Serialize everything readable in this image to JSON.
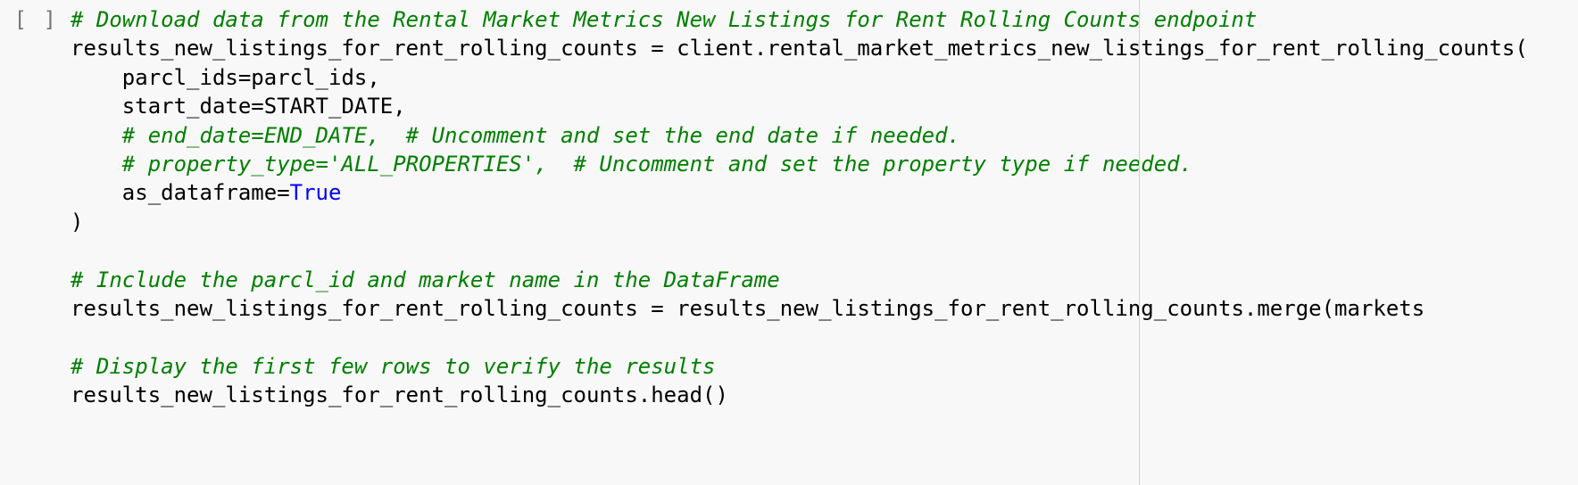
{
  "cell": {
    "execution_indicator": "[ ]",
    "lines": [
      [
        {
          "cls": "tok-comment",
          "text": "# Download data from the Rental Market Metrics New Listings for Rent Rolling Counts endpoint"
        }
      ],
      [
        {
          "cls": "tok-ident",
          "text": "results_new_listings_for_rent_rolling_counts "
        },
        {
          "cls": "tok-op",
          "text": "="
        },
        {
          "cls": "tok-ident",
          "text": " client"
        },
        {
          "cls": "tok-punct",
          "text": "."
        },
        {
          "cls": "tok-ident",
          "text": "rental_market_metrics_new_listings_for_rent_rolling_counts("
        }
      ],
      [
        {
          "cls": "tok-ident",
          "text": "    parcl_ids"
        },
        {
          "cls": "tok-op",
          "text": "="
        },
        {
          "cls": "tok-ident",
          "text": "parcl_ids"
        },
        {
          "cls": "tok-punct",
          "text": ","
        }
      ],
      [
        {
          "cls": "tok-ident",
          "text": "    start_date"
        },
        {
          "cls": "tok-op",
          "text": "="
        },
        {
          "cls": "tok-ident",
          "text": "START_DATE"
        },
        {
          "cls": "tok-punct",
          "text": ","
        }
      ],
      [
        {
          "cls": "tok-ident",
          "text": "    "
        },
        {
          "cls": "tok-comment",
          "text": "# end_date=END_DATE,  # Uncomment and set the end date if needed."
        }
      ],
      [
        {
          "cls": "tok-ident",
          "text": "    "
        },
        {
          "cls": "tok-comment",
          "text": "# property_type='ALL_PROPERTIES',  # Uncomment and set the property type if needed."
        }
      ],
      [
        {
          "cls": "tok-ident",
          "text": "    as_dataframe"
        },
        {
          "cls": "tok-op",
          "text": "="
        },
        {
          "cls": "tok-bool",
          "text": "True"
        }
      ],
      [
        {
          "cls": "tok-punct",
          "text": ")"
        }
      ],
      [
        {
          "cls": "tok-ident",
          "text": " "
        }
      ],
      [
        {
          "cls": "tok-comment",
          "text": "# Include the parcl_id and market name in the DataFrame"
        }
      ],
      [
        {
          "cls": "tok-ident",
          "text": "results_new_listings_for_rent_rolling_counts "
        },
        {
          "cls": "tok-op",
          "text": "="
        },
        {
          "cls": "tok-ident",
          "text": " results_new_listings_for_rent_rolling_counts"
        },
        {
          "cls": "tok-punct",
          "text": "."
        },
        {
          "cls": "tok-ident",
          "text": "merge"
        },
        {
          "cls": "tok-punct",
          "text": "("
        },
        {
          "cls": "tok-ident",
          "text": "markets"
        }
      ],
      [
        {
          "cls": "tok-ident",
          "text": " "
        }
      ],
      [
        {
          "cls": "tok-comment",
          "text": "# Display the first few rows to verify the results"
        }
      ],
      [
        {
          "cls": "tok-ident",
          "text": "results_new_listings_for_rent_rolling_counts"
        },
        {
          "cls": "tok-punct",
          "text": "."
        },
        {
          "cls": "tok-ident",
          "text": "head"
        },
        {
          "cls": "tok-punct",
          "text": "()"
        }
      ]
    ]
  }
}
